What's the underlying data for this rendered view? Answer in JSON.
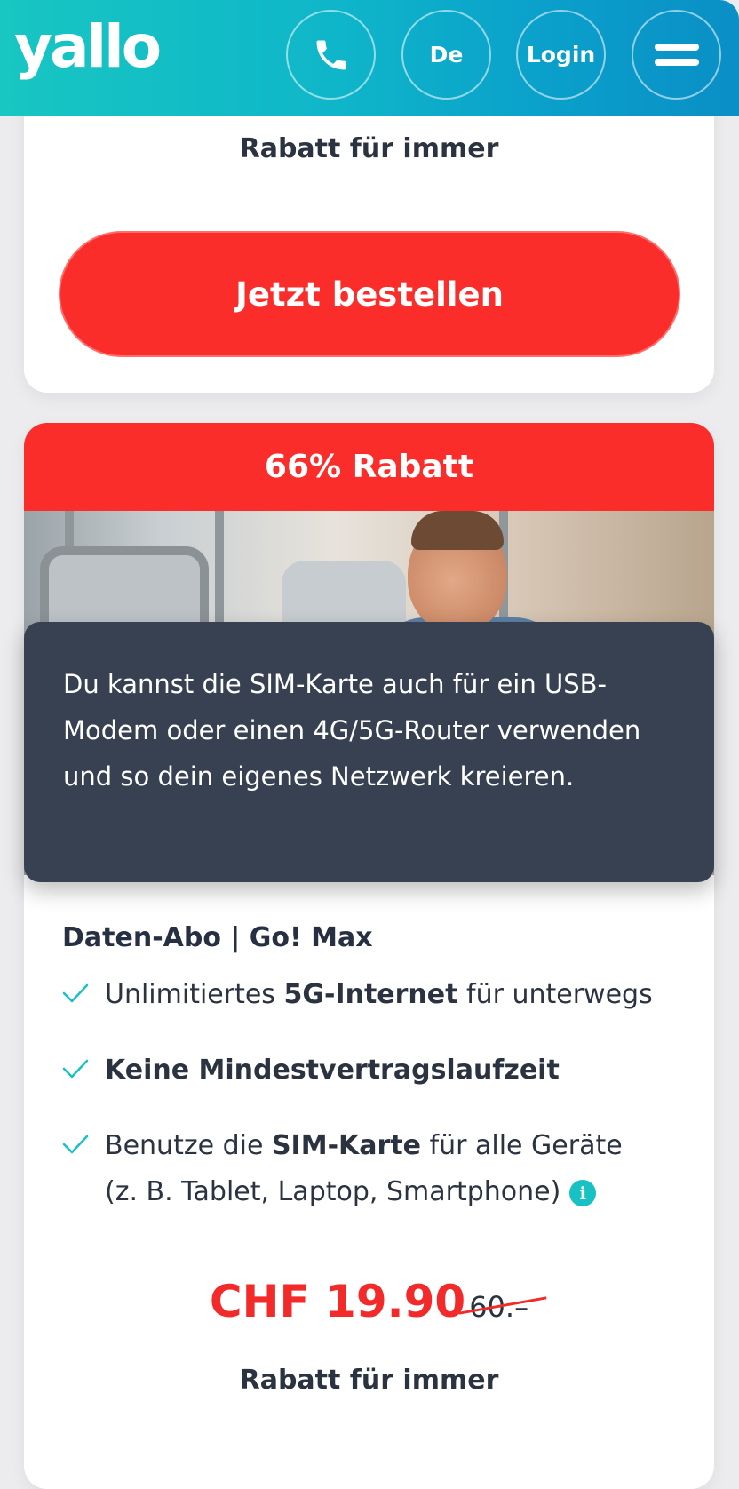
{
  "header": {
    "logo_text": "yallo",
    "phone_icon": "phone-icon",
    "language_label": "De",
    "login_label": "Login",
    "menu_icon": "hamburger-menu-icon",
    "gradient_start": "#18c6c2",
    "gradient_end": "#0a8fc6"
  },
  "top_card": {
    "discount_note": "Rabatt für immer",
    "order_button_label": "Jetzt bestellen"
  },
  "offer_card": {
    "banner_label": "66% Rabatt",
    "tooltip_text": "Du kannst die SIM-Karte auch für ein USB-Modem oder einen 4G/5G-Router verwenden und so dein eigenes Netzwerk kreieren.",
    "plan_title": "Daten-Abo | Go! Max",
    "features": [
      {
        "before": "Unlimitiertes ",
        "bold": "5G-Internet",
        "after": " für unterwegs"
      },
      {
        "before": "",
        "bold": "Keine Mindestvertragslaufzeit",
        "after": ""
      },
      {
        "before": "Benutze die ",
        "bold": "SIM-Karte",
        "after": " für alle Geräte (z. B. Tablet, Laptop, Smartphone)"
      }
    ],
    "check_icon": "check-icon",
    "info_icon": "info-icon",
    "price_now": "CHF 19.90",
    "price_old": "60.–",
    "discount_note": "Rabatt für immer"
  },
  "colors": {
    "accent_red": "#fb2d2a",
    "accent_teal": "#17c1c4",
    "tooltip_bg": "#374151"
  }
}
